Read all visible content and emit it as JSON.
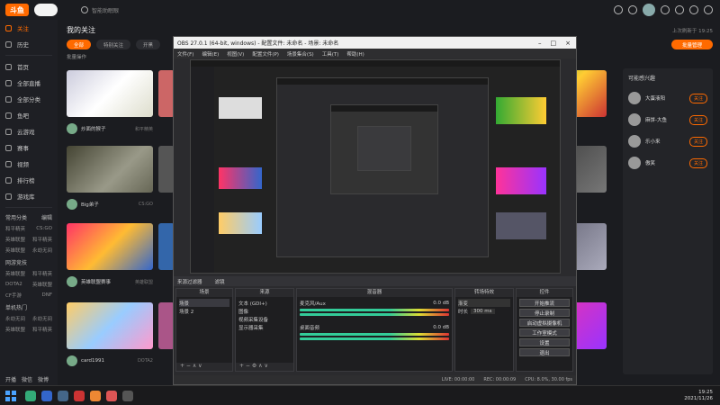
{
  "app": {
    "logo_text": "斗鱼",
    "top_search": "智能助眠眼"
  },
  "sidebar": {
    "items": [
      {
        "label": "关注",
        "active": true
      },
      {
        "label": "历史"
      },
      {
        "label": "首页"
      },
      {
        "label": "全部直播"
      },
      {
        "label": "全部分类"
      },
      {
        "label": "鱼吧"
      },
      {
        "label": "云游戏"
      },
      {
        "label": "赛事"
      },
      {
        "label": "视频"
      },
      {
        "label": "排行榜"
      },
      {
        "label": "游戏库"
      }
    ],
    "usual_section": "常用分类",
    "usual_edit": "编辑",
    "usual_rows": [
      [
        "和平精英",
        "CS:GO"
      ],
      [
        "英雄联盟",
        "和平精英"
      ],
      [
        "英雄联盟",
        "永劫无间"
      ]
    ],
    "online_section": "网游竞技",
    "online_rows": [
      [
        "英雄联盟",
        "和平精英"
      ],
      [
        "DOTA2",
        "英雄联盟"
      ],
      [
        "CF手游",
        "DNF"
      ]
    ],
    "mobile_section": "单机热门",
    "mobile_rows": [
      [
        "永劫无间",
        "永劫无间"
      ],
      [
        "英雄联盟",
        "和平精英"
      ]
    ],
    "bottom_links": [
      "开播",
      "微信",
      "微博"
    ]
  },
  "main": {
    "title": "我的关注",
    "update_note": "上次刷新于 19:25",
    "follow_button": "批量管理",
    "filters": [
      "全部",
      "特别关注",
      "开黑"
    ],
    "manage_link": "批量操作",
    "cards": [
      {
        "name": "炒面的猴子",
        "sub": "和平精英"
      },
      {
        "name": "Big弟子",
        "sub": "CS:GO"
      },
      {
        "name": "英雄联盟赛事",
        "sub": "英雄联盟"
      },
      {
        "name": "card1991",
        "sub": "DOTA2"
      }
    ]
  },
  "right_panel": {
    "title": "可能感兴趣",
    "items": [
      {
        "name": "大蛋液阳",
        "btn": "关注"
      },
      {
        "name": "麻饼-大鱼",
        "btn": "关注"
      },
      {
        "name": "乐小来",
        "btn": "关注"
      },
      {
        "name": "傲笑",
        "btn": "关注"
      }
    ]
  },
  "obs": {
    "title": "OBS 27.0.1 (64-bit, windows) - 配置文件: 未命名 - 场景: 未命名",
    "menu": [
      "文件(F)",
      "编辑(E)",
      "视图(V)",
      "配置文件(P)",
      "场景集合(S)",
      "工具(T)",
      "帮助(H)"
    ],
    "dock_tabs": [
      "来源过滤器",
      "滤镜"
    ],
    "scenes_title": "场景",
    "scenes": [
      "场景",
      "场景 2"
    ],
    "sources_title": "来源",
    "sources": [
      "文本 (GDI+)",
      "图像",
      "视频采集设备",
      "显示器采集"
    ],
    "mixer_title": "混音器",
    "mixer": [
      {
        "name": "麦克风/Aux",
        "db": "0.0 dB"
      },
      {
        "name": "桌面音频",
        "db": "0.0 dB"
      }
    ],
    "transitions_title": "转场特效",
    "transition_value": "渐变",
    "transition_duration_label": "时长",
    "transition_duration": "300 ms",
    "controls_title": "控件",
    "controls": [
      "开始推流",
      "停止录制",
      "启动虚拟摄像机",
      "工作室模式",
      "设置",
      "退出"
    ],
    "status": [
      "LIVE: 00:00:00",
      "REC: 00:00:09",
      "CPU: 8.0%, 30.00 fps"
    ]
  },
  "taskbar": {
    "time": "19:25",
    "date": "2021/11/26"
  }
}
